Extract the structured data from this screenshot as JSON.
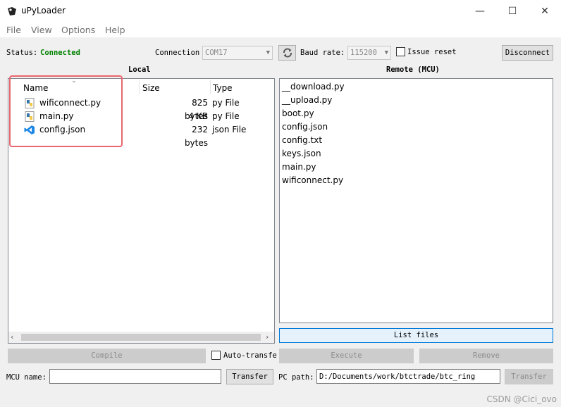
{
  "window": {
    "title": "uPyLoader",
    "minimize": "—",
    "maximize": "☐",
    "close": "✕"
  },
  "menu": [
    "File",
    "View",
    "Options",
    "Help"
  ],
  "status": {
    "label": "Status:",
    "value": "Connected",
    "connection_label": "Connection",
    "connection_value": "COM17",
    "baud_label": "Baud rate:",
    "baud_value": "115200",
    "issue_reset_label": "Issue reset",
    "disconnect_label": "Disconnect"
  },
  "local": {
    "title": "Local",
    "columns": [
      "Name",
      "Size",
      "Type"
    ],
    "files": [
      {
        "name": "wificonnect.py",
        "size": "825 bytes",
        "type": "py File",
        "icon": "python-file-icon"
      },
      {
        "name": "main.py",
        "size": "4 KB",
        "type": "py File",
        "icon": "python-file-icon"
      },
      {
        "name": "config.json",
        "size": "232 bytes",
        "type": "json File",
        "icon": "vscode-json-icon"
      }
    ]
  },
  "remote": {
    "title": "Remote (MCU)",
    "files": [
      "__download.py",
      "__upload.py",
      "boot.py",
      "config.json",
      "config.txt",
      "keys.json",
      "main.py",
      "wificonnect.py"
    ],
    "list_files_label": "List files"
  },
  "actions": {
    "compile_label": "Compile",
    "auto_transfer_label": "Auto-transfe",
    "execute_label": "Execute",
    "remove_label": "Remove"
  },
  "bottom": {
    "mcu_name_label": "MCU name:",
    "mcu_name_value": "",
    "transfer_label": "Transfer",
    "pc_path_label": "PC path:",
    "pc_path_value": "D:/Documents/work/btctrade/btc_ring",
    "transfer2_label": "Transfer"
  },
  "watermark": "CSDN @Cici_ovo"
}
